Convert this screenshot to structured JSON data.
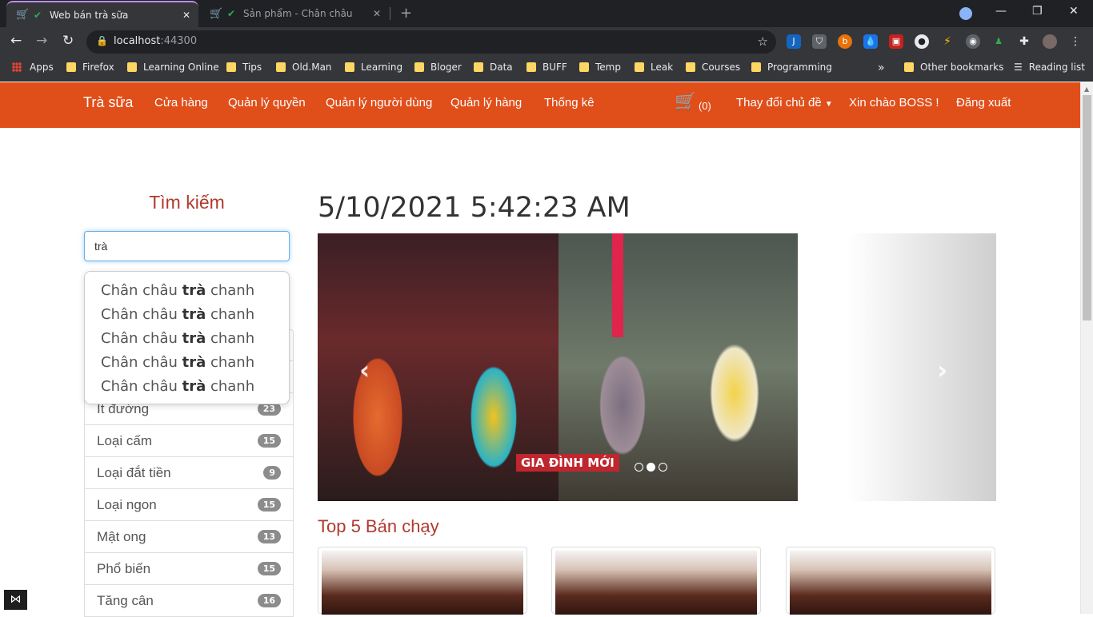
{
  "browser": {
    "tabs": [
      {
        "title": "Web bán trà sữa",
        "active": true
      },
      {
        "title": "Sản phẩm - Chân châu ...",
        "active": false
      }
    ],
    "url": {
      "host": "localhost",
      "port": ":44300"
    },
    "bookmarks": [
      {
        "label": "Apps"
      },
      {
        "label": "Firefox"
      },
      {
        "label": "Learning Online"
      },
      {
        "label": "Tips"
      },
      {
        "label": "Old.Man"
      },
      {
        "label": "Learning"
      },
      {
        "label": "Bloger"
      },
      {
        "label": "Data"
      },
      {
        "label": "BUFF"
      },
      {
        "label": "Temp"
      },
      {
        "label": "Leak"
      },
      {
        "label": "Courses"
      },
      {
        "label": "Programming"
      }
    ],
    "more_bookmarks": "»",
    "other_bookmarks": "Other bookmarks",
    "reading_list": "Reading list"
  },
  "site_nav": {
    "brand": "Trà sữa",
    "links": [
      "Cửa hàng",
      "Quản lý quyền",
      "Quản lý người dùng",
      "Quản lý hàng",
      "Thống kê"
    ],
    "cart_count": "(0)",
    "theme_label": "Thay đổi chủ đề",
    "greeting": "Xin chào BOSS !",
    "logout": "Đăng xuất"
  },
  "sidebar": {
    "search_title": "Tìm kiếm",
    "search_value": "trà",
    "suggestions": [
      {
        "pre": "Chân châu ",
        "match": "trà",
        "post": " chanh"
      },
      {
        "pre": "Chân châu ",
        "match": "trà",
        "post": " chanh"
      },
      {
        "pre": "Chân châu ",
        "match": "trà",
        "post": " chanh"
      },
      {
        "pre": "Chân châu ",
        "match": "trà",
        "post": " chanh"
      },
      {
        "pre": "Chân châu ",
        "match": "trà",
        "post": " chanh"
      }
    ],
    "categories": [
      {
        "label": "",
        "count": ""
      },
      {
        "label": "",
        "count": ""
      },
      {
        "label": "Ít đường",
        "count": "23"
      },
      {
        "label": "Loại cấm",
        "count": "15"
      },
      {
        "label": "Loại đắt tiền",
        "count": "9"
      },
      {
        "label": "Loại ngon",
        "count": "15"
      },
      {
        "label": "Mật ong",
        "count": "13"
      },
      {
        "label": "Phổ biến",
        "count": "15"
      },
      {
        "label": "Tăng cân",
        "count": "16"
      }
    ]
  },
  "main": {
    "datetime": "5/10/2021 5:42:23 AM",
    "carousel": {
      "watermark": "GIA ĐÌNH MỚI",
      "dot_count": 3,
      "active_dot": 1
    },
    "top_title": "Top 5 Bán chạy"
  }
}
